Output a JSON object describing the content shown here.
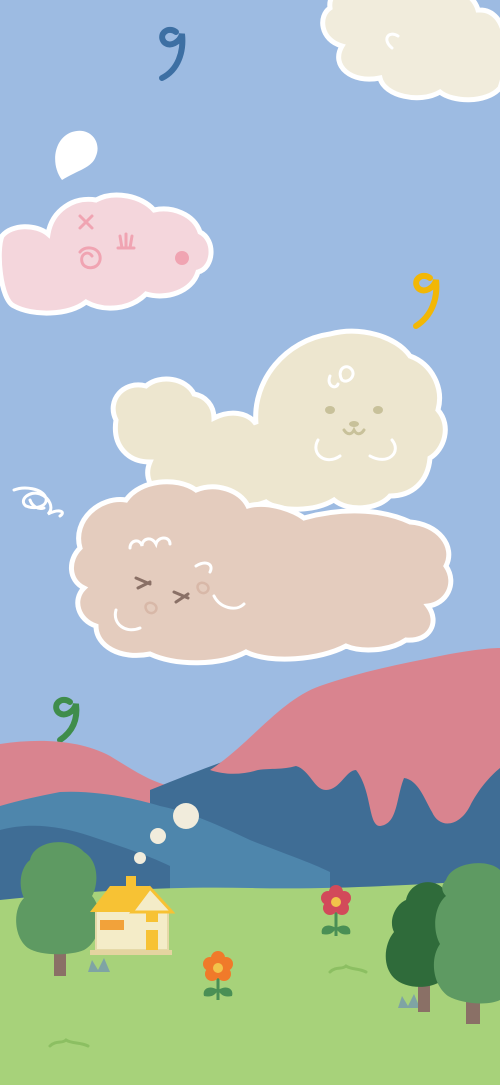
{
  "scene": {
    "kind": "illustrated phone wallpaper",
    "colors": {
      "sky": "#9dbbe2",
      "cloud_cream": "#f1ecdc",
      "cloud_pink": "#f4d6dc",
      "puppy_cream": "#ede6cf",
      "puppy_tan": "#e4ccbe",
      "mountain_pink": "#d9848f",
      "mountain_pink_dark": "#cf7481",
      "mountain_blue": "#3f6d95",
      "mountain_teal": "#4e86ac",
      "grass": "#a7d27a",
      "tree_green": "#5e9a62",
      "tree_dark": "#2f6b3a",
      "trunk": "#8a7066",
      "house_wall": "#f4ecc8",
      "house_roof": "#f7c234",
      "flower_red": "#d24a5a",
      "flower_orange": "#f07a2a",
      "note_blue": "#3d6fa3",
      "note_yellow": "#f2b705",
      "note_green": "#3f8d4b"
    },
    "icons": [
      "music-note-icon",
      "speech-bubble-icon",
      "scribble-icon",
      "house-icon",
      "flower-icon",
      "tree-icon"
    ]
  }
}
